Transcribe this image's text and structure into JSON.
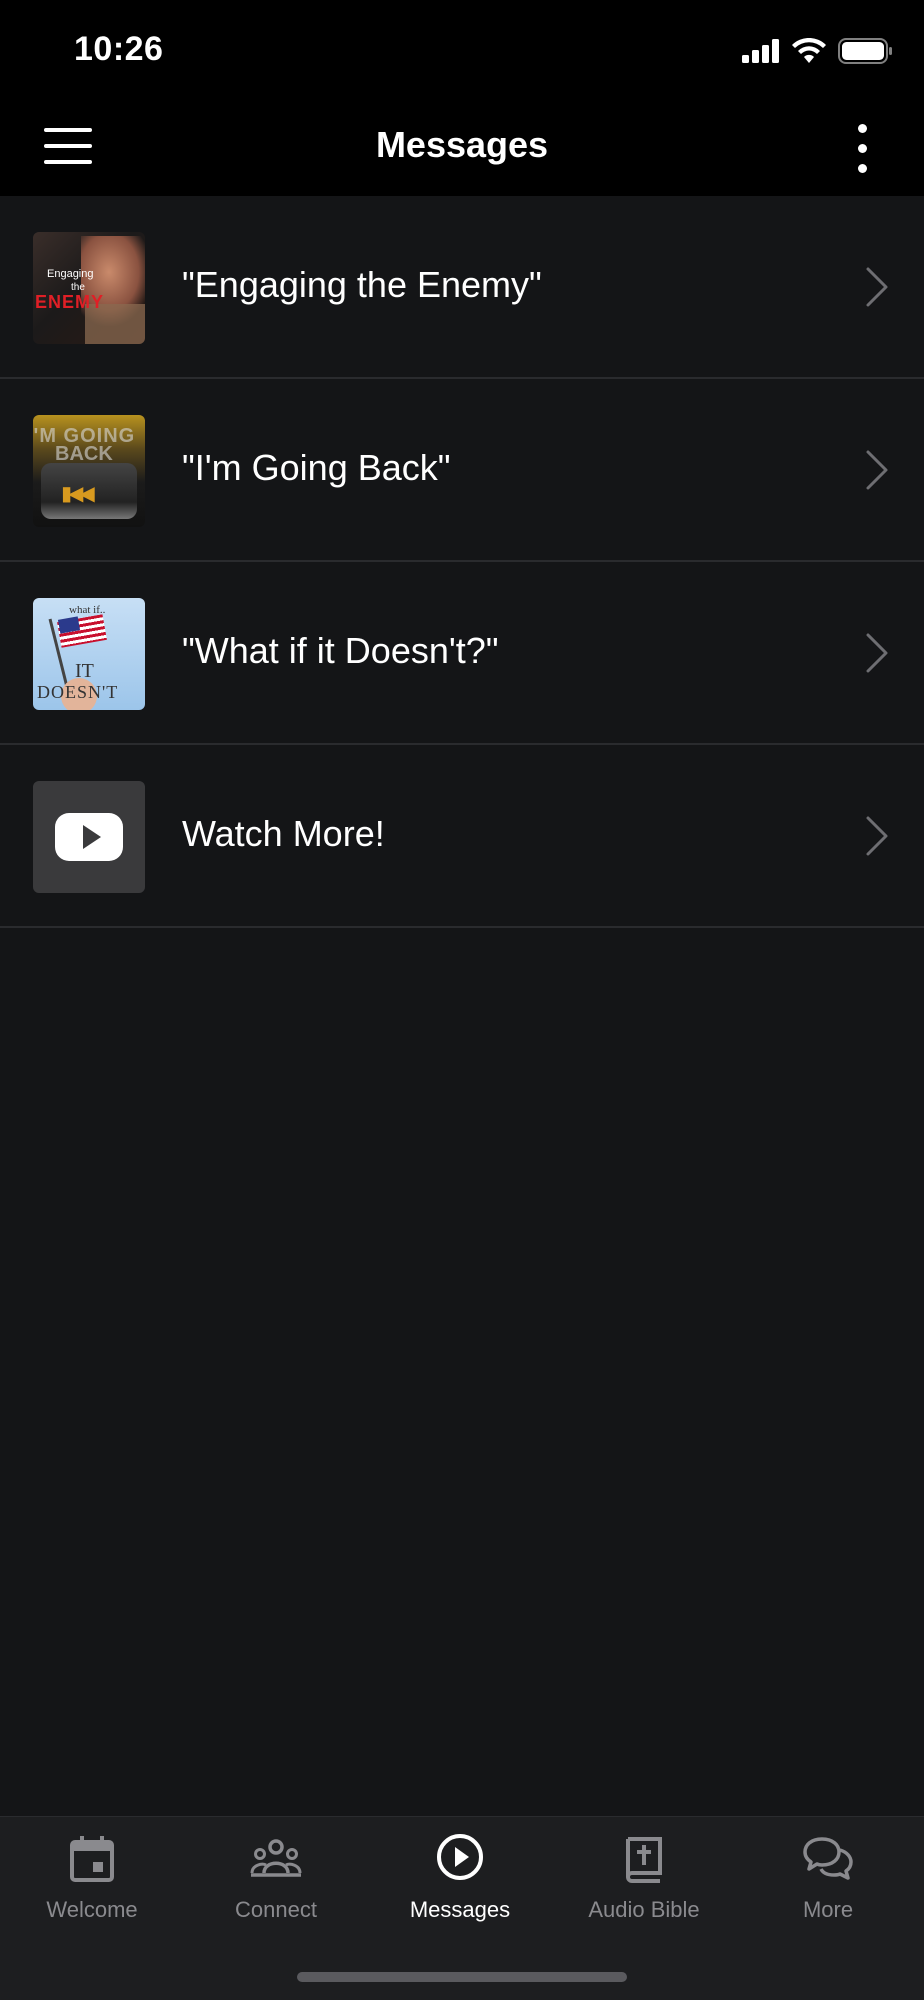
{
  "status_bar": {
    "time": "10:26",
    "icons": [
      "signal-icon",
      "wifi-icon",
      "battery-icon"
    ]
  },
  "header": {
    "title": "Messages",
    "left_icon": "hamburger-menu-icon",
    "right_icon": "more-vertical-icon"
  },
  "list": {
    "items": [
      {
        "label": "\"Engaging the Enemy\"",
        "thumb_text": [
          "Engaging",
          "the",
          "ENEMY"
        ]
      },
      {
        "label": "\"I'm Going Back\"",
        "thumb_text": [
          "I'M GOING",
          "BACK"
        ]
      },
      {
        "label": "\"What if it Doesn't?\"",
        "thumb_text": [
          "what if..",
          "IT",
          "DOESN'T"
        ]
      },
      {
        "label": "Watch More!",
        "thumb_icon": "youtube-icon"
      }
    ]
  },
  "tab_bar": {
    "tabs": [
      {
        "label": "Welcome",
        "icon": "calendar-icon",
        "active": false
      },
      {
        "label": "Connect",
        "icon": "group-icon",
        "active": false
      },
      {
        "label": "Messages",
        "icon": "play-circle-icon",
        "active": true
      },
      {
        "label": "Audio Bible",
        "icon": "bible-icon",
        "active": false
      },
      {
        "label": "More",
        "icon": "chat-bubbles-icon",
        "active": false
      }
    ]
  },
  "colors": {
    "background": "#141517",
    "header_bg": "#000000",
    "tab_bar_bg": "#1d1e20",
    "tab_inactive": "#8a8a8e",
    "tab_active": "#ffffff",
    "divider": "#2a2b2e"
  }
}
